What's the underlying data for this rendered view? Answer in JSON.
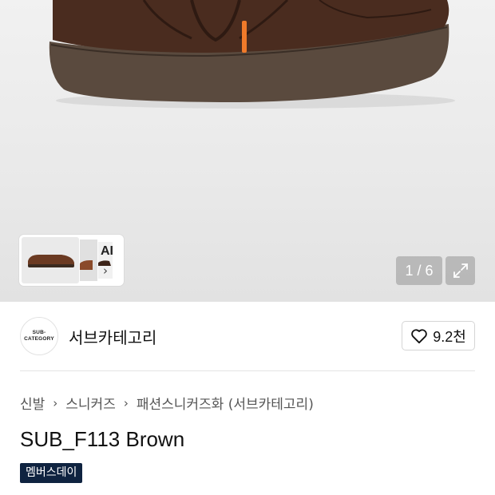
{
  "gallery": {
    "counter": "1 / 6",
    "ai_label": "AI",
    "ai_chevron": "›",
    "colors": {
      "shoe_suede": "#4a2c1f",
      "sole": "#5a4a3e",
      "lace_tip": "#f07a2a"
    }
  },
  "brand": {
    "logo_line1": "SUB-",
    "logo_line2": "CATEGORY",
    "name": "서브카테고리",
    "likes": "9.2천"
  },
  "breadcrumb": {
    "items": [
      "신발",
      "스니커즈",
      "패션스니커즈화 (서브카테고리)"
    ],
    "separator": "›"
  },
  "product": {
    "title": "SUB_F113 Brown",
    "badge": "멤버스데이",
    "badge_color": "#0f2340"
  }
}
